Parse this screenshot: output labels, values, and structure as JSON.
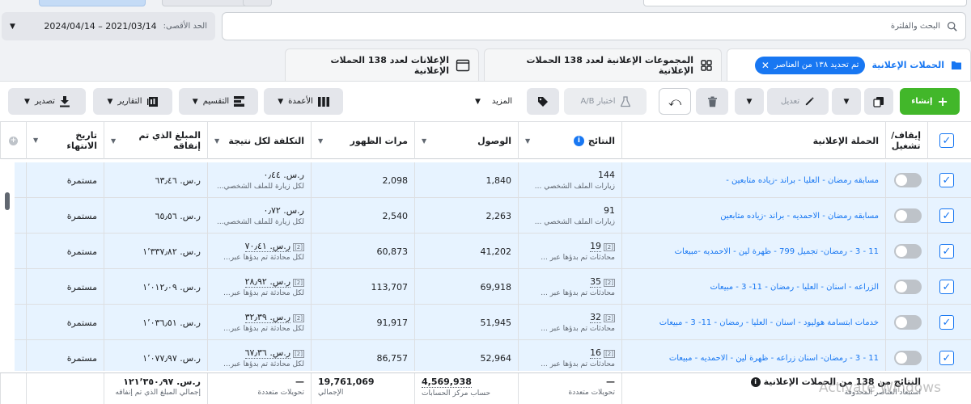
{
  "search": {
    "placeholder": "البحث والفلترة"
  },
  "date_range": {
    "label": "الحد الأقصى:",
    "value": "2024/04/14 – 2021/03/14"
  },
  "tabs": {
    "campaigns": {
      "label": "الحملات الإعلانية",
      "chip": "تم تحديد ١٣٨ من العناصر"
    },
    "adsets": {
      "label": "المجموعات الإعلانية لعدد 138 الحملات الإعلانية"
    },
    "ads": {
      "label": "الإعلانات لعدد 138 الحملات الإعلانية"
    }
  },
  "toolbar": {
    "create": "إنشاء",
    "edit": "تعديل",
    "ab_test": "اختبار A/B",
    "more": "المزيد",
    "columns": "الأعمدة",
    "breakdown": "التقسيم",
    "reports": "التقارير",
    "export": "تصدير"
  },
  "columns": {
    "toggle": "إيقاف/ تشغيل",
    "campaign": "الحملة الإعلانية",
    "results": "النتائج",
    "reach": "الوصول",
    "impressions": "مرات الظهور",
    "cost_per_result": "التكلفة لكل نتيجة",
    "amount_spent": "المبلغ الذي تم إنفاقه",
    "end_date": "تاريخ الانتهاء"
  },
  "rows": [
    {
      "campaign": "مسابقه رمضان - العليا - براند -زياده متابعين -",
      "results": "144",
      "results_sub": "زيارات الملف الشخصي ...",
      "results_badge": "",
      "reach": "1,840",
      "impressions": "2,098",
      "cost": "ر.س. ٠٫٤٤",
      "cost_sub": "لكل زيارة للملف الشخصي...",
      "cost_badge": "",
      "spent": "ر.س. ٦٣٫٤٦",
      "end": "مستمرة"
    },
    {
      "campaign": "مسابقه رمضان - الاحمديه - براند -زياده متابعين",
      "results": "91",
      "results_sub": "زيارات الملف الشخصي ...",
      "results_badge": "",
      "reach": "2,263",
      "impressions": "2,540",
      "cost": "ر.س. ٠٫٧٢",
      "cost_sub": "لكل زيارة للملف الشخصي...",
      "cost_badge": "",
      "spent": "ر.س. ٦٥٫٥٦",
      "end": "مستمرة"
    },
    {
      "campaign": "11 - 3 - رمضان- تجميل 799 - ظهرة لين - الاحمديه -مبيعات",
      "results": "19",
      "results_sub": "محادثات تم بدؤها عبر ...",
      "results_badge": "[2]",
      "reach": "41,202",
      "impressions": "60,873",
      "cost": "ر.س. ٧٠٫٤١",
      "cost_sub": "لكل محادثة تم بدؤها عبر...",
      "cost_badge": "[2]",
      "spent": "ر.س. ١٬٣٣٧٫٨٢",
      "end": "مستمرة"
    },
    {
      "campaign": "الزراعه - اسنان - العليا - رمضان - 11- 3 - مبيعات",
      "results": "35",
      "results_sub": "محادثات تم بدؤها عبر ...",
      "results_badge": "[2]",
      "reach": "69,918",
      "impressions": "113,707",
      "cost": "ر.س. ٢٨٫٩٢",
      "cost_sub": "لكل محادثة تم بدؤها عبر...",
      "cost_badge": "[2]",
      "spent": "ر.س. ١٬٠١٢٫٠٩",
      "end": "مستمرة"
    },
    {
      "campaign": "خدمات ابتسامة هوليود - اسنان - العليا - رمضان - 11- 3 - مبيعات",
      "results": "32",
      "results_sub": "محادثات تم بدؤها عبر ...",
      "results_badge": "[2]",
      "reach": "51,945",
      "impressions": "91,917",
      "cost": "ر.س. ٣٢٫٣٩",
      "cost_sub": "لكل محادثة تم بدؤها عبر...",
      "cost_badge": "[2]",
      "spent": "ر.س. ١٬٠٣٦٫٥١",
      "end": "مستمرة"
    },
    {
      "campaign": "11 - 3 - رمضان- اسنان زراعه - ظهرة لين - الاحمديه - مبيعات",
      "results": "16",
      "results_sub": "محادثات تم بدؤها عبر ...",
      "results_badge": "[2]",
      "reach": "52,964",
      "impressions": "86,757",
      "cost": "ر.س. ٦٧٫٣٦",
      "cost_sub": "لكل محادثة تم بدؤها عبر...",
      "cost_badge": "[2]",
      "spent": "ر.س. ١٬٠٧٧٫٩٧",
      "end": "مستمرة"
    }
  ],
  "footer": {
    "title": "النتائج من 138 من الحملات الإعلانية",
    "title_sub": "استبعاد العناصر المحذوفة",
    "results": "—",
    "results_sub": "تحويلات متعددة",
    "reach": "4,569,938",
    "reach_sub": "حساب مركز الحسابات",
    "impressions": "19,761,069",
    "impressions_sub": "الإجمالي",
    "cost": "—",
    "cost_sub": "تحويلات متعددة",
    "spent": "ر.س. ١٢١٬٣٥٠٫٩٧",
    "spent_sub": "إجمالي المبلغ الذي تم إنفاقه"
  },
  "watermark": "Activate Windows",
  "colors": {
    "accent": "#1877f2",
    "create": "#42b72a",
    "row_selected": "#e7f3ff"
  }
}
